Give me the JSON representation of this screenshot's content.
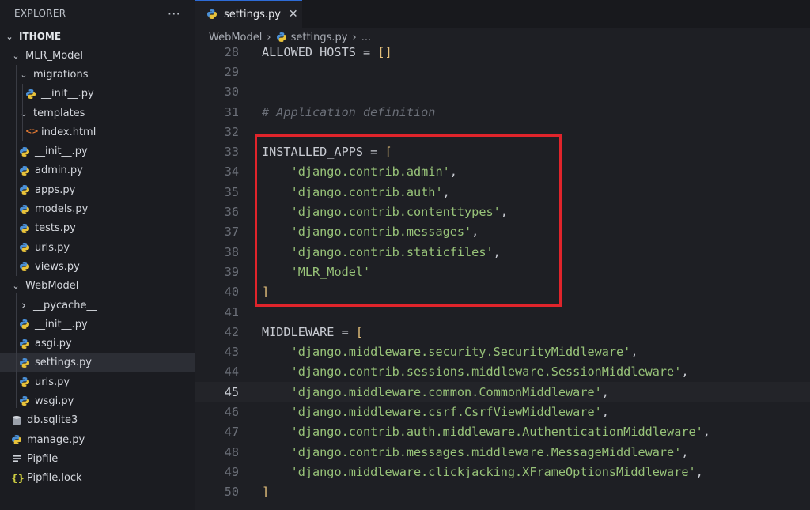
{
  "explorer": {
    "title": "EXPLORER",
    "more": "···",
    "root": "ITHOME",
    "items": [
      {
        "label": "MLR_Model",
        "type": "folder-open"
      },
      {
        "label": "migrations",
        "type": "folder-open"
      },
      {
        "label": "__init__.py",
        "type": "python"
      },
      {
        "label": "templates",
        "type": "folder-open"
      },
      {
        "label": "index.html",
        "type": "html"
      },
      {
        "label": "__init__.py",
        "type": "python"
      },
      {
        "label": "admin.py",
        "type": "python"
      },
      {
        "label": "apps.py",
        "type": "python"
      },
      {
        "label": "models.py",
        "type": "python"
      },
      {
        "label": "tests.py",
        "type": "python"
      },
      {
        "label": "urls.py",
        "type": "python"
      },
      {
        "label": "views.py",
        "type": "python"
      },
      {
        "label": "WebModel",
        "type": "folder-open"
      },
      {
        "label": "__pycache__",
        "type": "folder-closed"
      },
      {
        "label": "__init__.py",
        "type": "python"
      },
      {
        "label": "asgi.py",
        "type": "python"
      },
      {
        "label": "settings.py",
        "type": "python"
      },
      {
        "label": "urls.py",
        "type": "python"
      },
      {
        "label": "wsgi.py",
        "type": "python"
      },
      {
        "label": "db.sqlite3",
        "type": "database"
      },
      {
        "label": "manage.py",
        "type": "python"
      },
      {
        "label": "Pipfile",
        "type": "file"
      },
      {
        "label": "Pipfile.lock",
        "type": "json"
      }
    ]
  },
  "tab": {
    "label": "settings.py",
    "close": "✕"
  },
  "breadcrumb": {
    "folder": "WebModel",
    "file": "settings.py",
    "more": "..."
  },
  "editor": {
    "current_line": "45",
    "lines": [
      {
        "n": "28",
        "t": "ALLOWED_HOSTS = []"
      },
      {
        "n": "29",
        "t": ""
      },
      {
        "n": "30",
        "t": ""
      },
      {
        "n": "31",
        "t": "# Application definition"
      },
      {
        "n": "32",
        "t": ""
      },
      {
        "n": "33",
        "t": "INSTALLED_APPS = ["
      },
      {
        "n": "34",
        "t": "    'django.contrib.admin',"
      },
      {
        "n": "35",
        "t": "    'django.contrib.auth',"
      },
      {
        "n": "36",
        "t": "    'django.contrib.contenttypes',"
      },
      {
        "n": "37",
        "t": "    'django.contrib.messages',"
      },
      {
        "n": "38",
        "t": "    'django.contrib.staticfiles',"
      },
      {
        "n": "39",
        "t": "    'MLR_Model'"
      },
      {
        "n": "40",
        "t": "]"
      },
      {
        "n": "41",
        "t": ""
      },
      {
        "n": "42",
        "t": "MIDDLEWARE = ["
      },
      {
        "n": "43",
        "t": "    'django.middleware.security.SecurityMiddleware',"
      },
      {
        "n": "44",
        "t": "    'django.contrib.sessions.middleware.SessionMiddleware',"
      },
      {
        "n": "45",
        "t": "    'django.middleware.common.CommonMiddleware',"
      },
      {
        "n": "46",
        "t": "    'django.middleware.csrf.CsrfViewMiddleware',"
      },
      {
        "n": "47",
        "t": "    'django.contrib.auth.middleware.AuthenticationMiddleware',"
      },
      {
        "n": "48",
        "t": "    'django.contrib.messages.middleware.MessageMiddleware',"
      },
      {
        "n": "49",
        "t": "    'django.middleware.clickjacking.XFrameOptionsMiddleware',"
      },
      {
        "n": "50",
        "t": "]"
      }
    ]
  },
  "colors": {
    "string": "#98c379",
    "bracket": "#e5c07b",
    "comment": "#6b6f78",
    "highlight": "#e0242b"
  }
}
